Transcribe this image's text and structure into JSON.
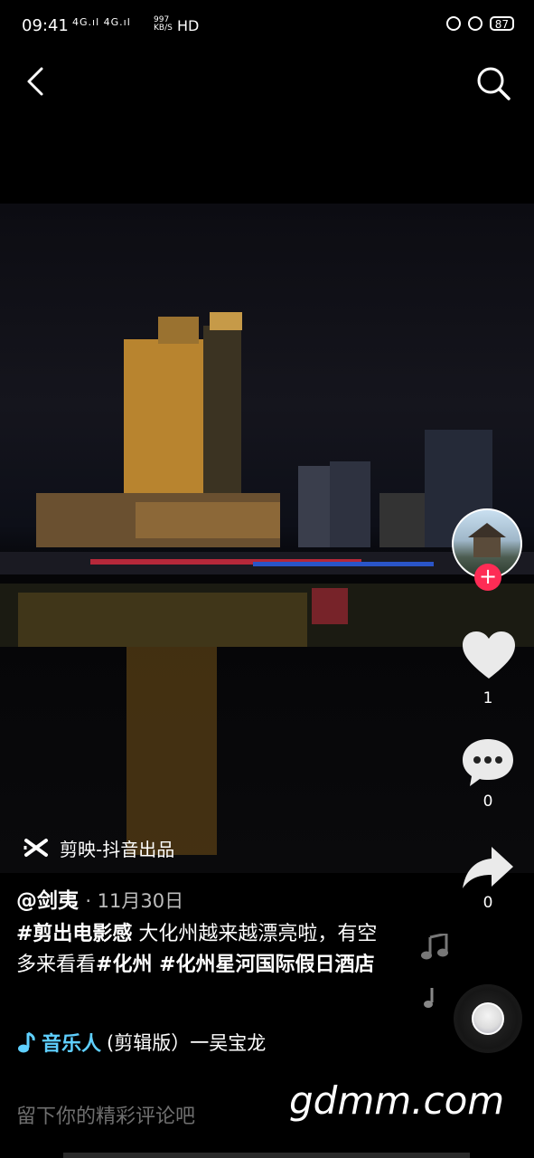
{
  "status_bar": {
    "time": "09:41",
    "signals": "4G.ıl 4G.ıl",
    "net_speed_value": "997",
    "net_speed_unit": "KB/S",
    "hd": "HD",
    "battery": "87"
  },
  "top_bar": {
    "back_icon": "chevron-left-icon",
    "search_icon": "search-icon"
  },
  "right_rail": {
    "like_count": "1",
    "comment_count": "0",
    "share_count": "0"
  },
  "brand": {
    "label": "剪映-抖音出品"
  },
  "post": {
    "author": "@剑夷",
    "date": "· 11月30日",
    "caption_parts": {
      "tag1": "#剪出电影感",
      "text1": " 大化州越来越漂亮啦，有空多来看看",
      "tag2": "#化州",
      "tag3": " #化州星河国际假日酒店"
    }
  },
  "music": {
    "artist": "音乐人",
    "title": "(剪辑版）一吴宝龙"
  },
  "comment_bar": {
    "placeholder": "留下你的精彩评论吧"
  },
  "watermark": "gdmm.com",
  "colors": {
    "accent_red": "#fe2c55",
    "music_blue": "#5fd0ff"
  }
}
